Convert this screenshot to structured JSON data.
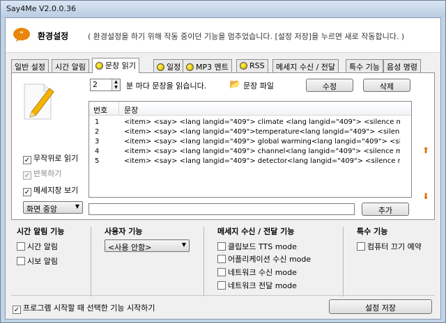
{
  "window": {
    "title": "Say4Me V2.0.0.36"
  },
  "header": {
    "title": "환경설정",
    "description": "( 환경설정을 하기 위해 작동 중이던 기능을 멈추었습니다. [설정 저장]을 누르면 새로 작동합니다. )"
  },
  "tabs": [
    {
      "label": "일반 설정",
      "icon": ""
    },
    {
      "label": "시간 알림",
      "icon": ""
    },
    {
      "label": "문장 읽기",
      "icon": "yellow-dot-icon"
    },
    {
      "label": "일정",
      "icon": "yellow-dot-icon"
    },
    {
      "label": "MP3 멘트",
      "icon": "yellow-dot-icon"
    },
    {
      "label": "RSS",
      "icon": "yellow-dot-icon"
    },
    {
      "label": "메세지 수신 / 전달",
      "icon": ""
    },
    {
      "label": "특수 기능",
      "icon": ""
    },
    {
      "label": "음성 명령",
      "icon": ""
    }
  ],
  "sentence_panel": {
    "interval_value": "2",
    "interval_label": "분 마다 문장을 읽습니다.",
    "file_label": "문장 파일",
    "edit_button": "수정",
    "delete_button": "삭제",
    "list_columns": [
      "번호",
      "문장"
    ],
    "rows": [
      {
        "num": "1",
        "text": "<item> <say> <lang langid=\"409\"> climate <lang langid=\"409\"> <silence msec..."
      },
      {
        "num": "2",
        "text": "<item> <say> <lang langid=\"409\">temperature<lang langid=\"409\"> <silence ..."
      },
      {
        "num": "3",
        "text": "<item> <say> <lang langid=\"409\"> global warming<lang langid=\"409\"> <silen..."
      },
      {
        "num": "4",
        "text": "<item> <say> <lang langid=\"409\"> channel<lang langid=\"409\"> <silence mse..."
      },
      {
        "num": "5",
        "text": "<item> <say> <lang langid=\"409\"> detector<lang langid=\"409\"> <silence mse..."
      }
    ],
    "random_read": {
      "label": "무작위로 읽기",
      "checked": true
    },
    "repeat": {
      "label": "반복하기",
      "checked": true,
      "disabled": true
    },
    "show_message": {
      "label": "메세지창 보기",
      "checked": true
    },
    "position_combo": "화면 중앙",
    "add_button": "추가",
    "new_sentence_value": ""
  },
  "groups": {
    "time_alert": {
      "title": "시간 알림 기능",
      "items": [
        {
          "label": "시간 알림",
          "checked": false
        },
        {
          "label": "시보 알림",
          "checked": false
        }
      ]
    },
    "user": {
      "title": "사용자 기능",
      "combo": "<사용 안함>"
    },
    "message": {
      "title": "메세지 수신 / 전달 기능",
      "items": [
        {
          "label": "클립보드 TTS mode",
          "checked": false
        },
        {
          "label": "어플리케이션 수신 mode",
          "checked": false
        },
        {
          "label": "네트워크 수신 mode",
          "checked": false
        },
        {
          "label": "네트워크 전달 mode",
          "checked": false
        }
      ]
    },
    "special": {
      "title": "특수 기능",
      "items": [
        {
          "label": "컴퓨터 끄기 예약",
          "checked": false
        }
      ]
    }
  },
  "footer": {
    "start_selected": {
      "label": "프로그램 시작할 때 선택한 기능 시작하기",
      "checked": true
    },
    "save_button": "설정 저장"
  },
  "colors": {
    "accent_arrow": "#e07000",
    "tab_dot": "#e5c500",
    "logo": "#e8860c"
  }
}
